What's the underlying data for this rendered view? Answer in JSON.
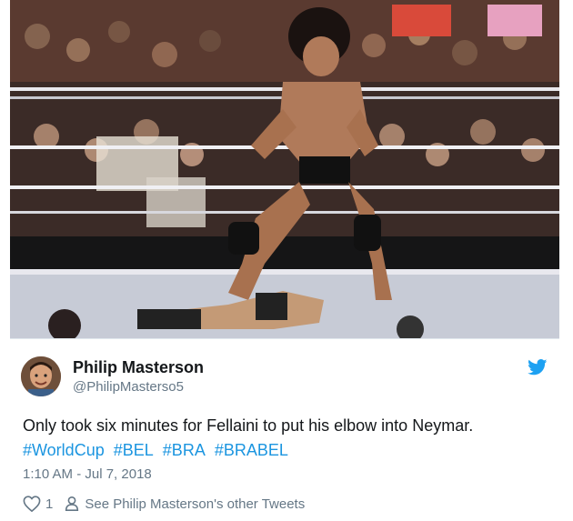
{
  "media": {
    "description_icon": "wrestling-ring-photo"
  },
  "author": {
    "name": "Philip Masterson",
    "handle": "@PhilipMasterso5",
    "avatar_icon": "avatar"
  },
  "tweet": {
    "text": "Only took six minutes for Fellaini to put his elbow into Neymar.",
    "hashtags": [
      "#WorldCup",
      "#BEL",
      "#BRA",
      "#BRABEL"
    ],
    "timestamp": "1:10 AM - Jul 7, 2018"
  },
  "actions": {
    "like_count": "1",
    "like_icon": "heart-icon",
    "profile_icon": "person-icon",
    "profile_link": "See Philip Masterson's other Tweets"
  },
  "colors": {
    "link": "#1b95e0",
    "text": "#14171a",
    "muted": "#657786",
    "twitter_blue": "#1da1f2"
  }
}
